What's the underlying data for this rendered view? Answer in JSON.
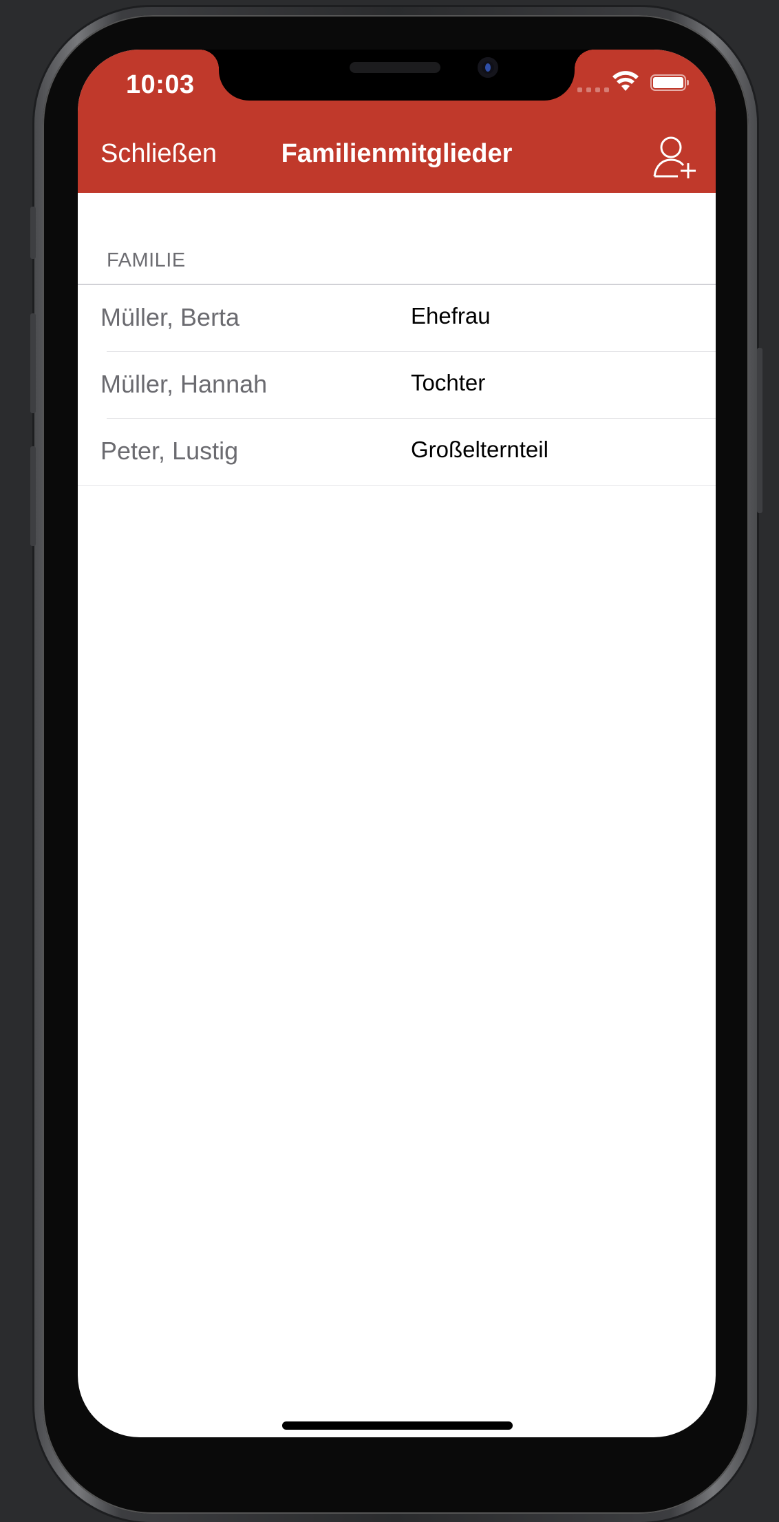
{
  "status_bar": {
    "time": "10:03",
    "icons": [
      "cellular-signal-icon",
      "wifi-icon",
      "battery-icon"
    ]
  },
  "nav": {
    "close_label": "Schließen",
    "title": "Familienmitglieder",
    "add_icon": "add-person-icon"
  },
  "section": {
    "header": "FAMILIE"
  },
  "members": [
    {
      "name": "Müller, Berta",
      "relation": "Ehefrau"
    },
    {
      "name": "Müller, Hannah",
      "relation": "Tochter"
    },
    {
      "name": "Peter, Lustig",
      "relation": "Großelternteil"
    }
  ],
  "colors": {
    "accent": "#c0392b",
    "background": "#ffffff",
    "device_background": "#2b2c2e"
  }
}
